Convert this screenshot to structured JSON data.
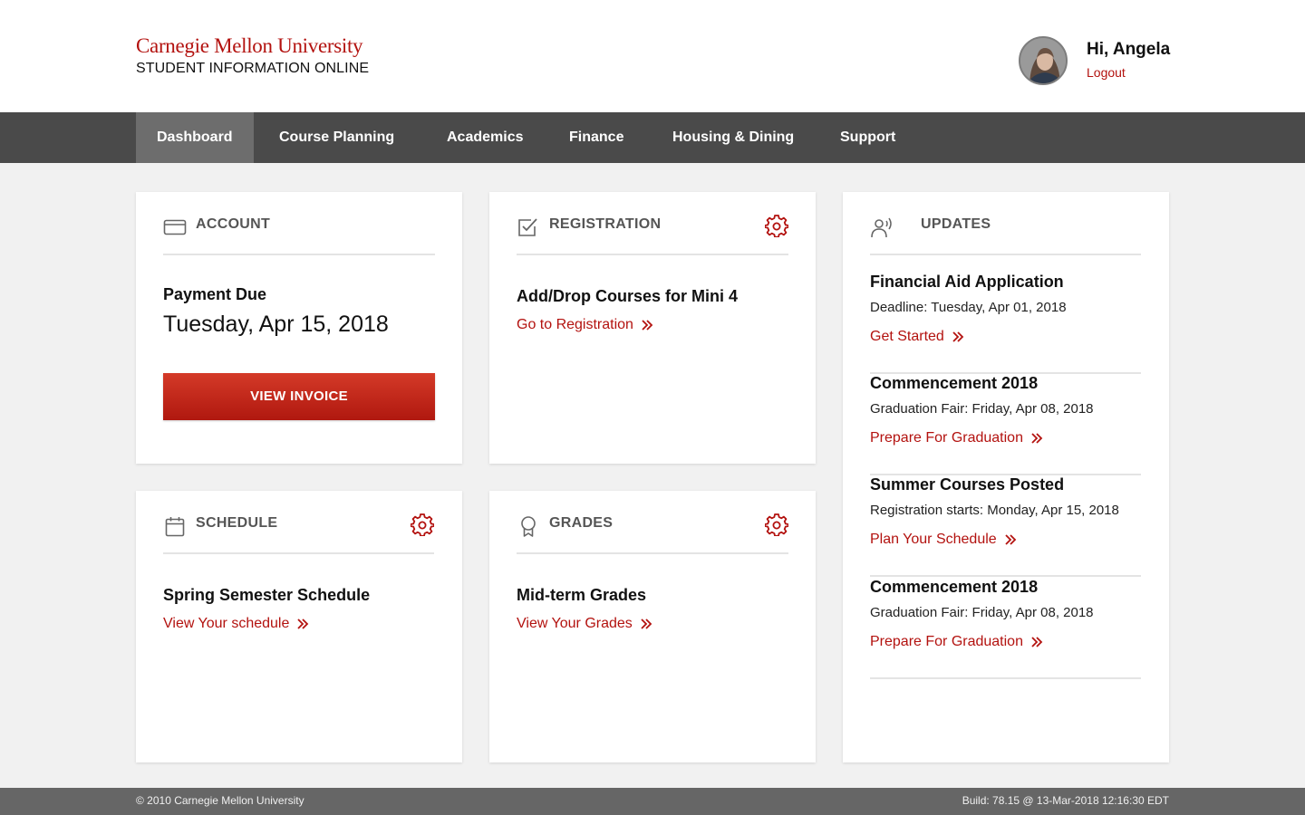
{
  "brand": {
    "name": "Carnegie Mellon University",
    "subtitle": "STUDENT INFORMATION ONLINE",
    "color": "#b3120f"
  },
  "user": {
    "greeting": "Hi, Angela",
    "logout_label": "Logout",
    "avatar_icon": "user-avatar-photo"
  },
  "nav": {
    "items": [
      {
        "label": "Dashboard",
        "active": true
      },
      {
        "label": "Course Planning"
      },
      {
        "label": "Academics"
      },
      {
        "label": "Finance"
      },
      {
        "label": "Housing & Dining"
      },
      {
        "label": "Support"
      }
    ]
  },
  "account": {
    "title": "ACCOUNT",
    "icon": "credit-card-icon",
    "item_title": "Payment Due",
    "date": "Tuesday, Apr 15, 2018",
    "button_label": "VIEW INVOICE"
  },
  "registration": {
    "title": "REGISTRATION",
    "icon": "checkbox-icon",
    "item_title": "Add/Drop Courses for Mini 4",
    "link_label": "Go to Registration"
  },
  "schedule": {
    "title": "SCHEDULE",
    "icon": "calendar-icon",
    "item_title": "Spring Semester Schedule",
    "link_label": "View Your schedule"
  },
  "grades": {
    "title": "GRADES",
    "icon": "award-ribbon-icon",
    "item_title": "Mid-term Grades",
    "link_label": "View Your Grades"
  },
  "updates": {
    "title": "UPDATES",
    "icon": "announcement-icon",
    "items": [
      {
        "title": "Financial Aid Application",
        "subtitle": "Deadline: Tuesday, Apr 01, 2018",
        "link": "Get Started"
      },
      {
        "title": "Commencement 2018",
        "subtitle": "Graduation Fair: Friday, Apr 08, 2018",
        "link": "Prepare For Graduation"
      },
      {
        "title": "Summer Courses Posted",
        "subtitle": "Registration starts:  Monday, Apr 15, 2018",
        "link": "Plan Your Schedule"
      },
      {
        "title": "Commencement 2018",
        "subtitle": "Graduation Fair: Friday, Apr 08, 2018",
        "link": "Prepare For Graduation"
      }
    ]
  },
  "footer": {
    "copyright": "© 2010 Carnegie Mellon University",
    "build": "Build: 78.15 @ 13-Mar-2018 12:16:30 EDT"
  }
}
